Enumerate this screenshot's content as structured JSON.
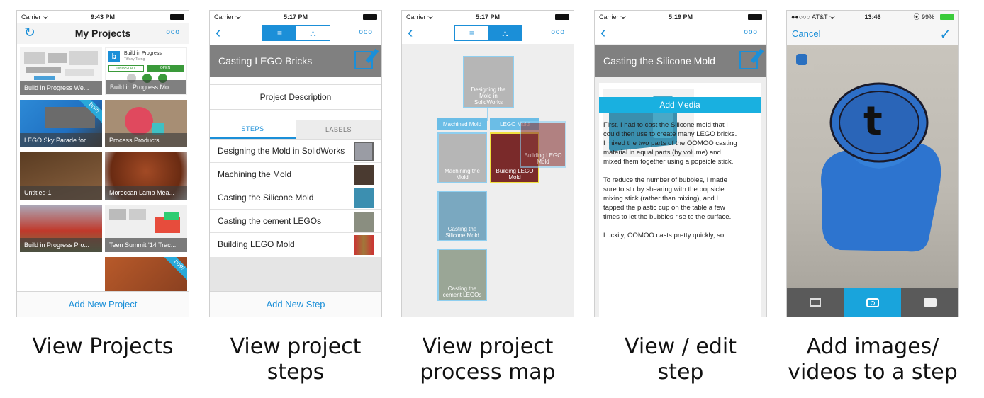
{
  "screens": [
    {
      "status": {
        "carrier": "Carrier ᯤ",
        "time": "9:43 PM"
      },
      "title": "My Projects",
      "more": "ooo",
      "projects": [
        {
          "label": "Build in Progress We..."
        },
        {
          "label": "Build in Progress Mo..."
        },
        {
          "label": "LEGO Sky Parade for..."
        },
        {
          "label": "Process Products"
        },
        {
          "label": "Untitled-1"
        },
        {
          "label": "Moroccan Lamb Mea..."
        },
        {
          "label": "Build in Progress Pro..."
        },
        {
          "label": "Teen Summit '14 Trac..."
        }
      ],
      "promo": {
        "title": "Build in Progress",
        "author": "Tiffany Tseng",
        "btn1": "UNINSTALL",
        "btn2": "OPEN"
      },
      "ribbon": "built!",
      "bottom": "Add New Project",
      "caption": "View Projects"
    },
    {
      "status": {
        "carrier": "Carrier ᯤ",
        "time": "5:17 PM"
      },
      "more": "ooo",
      "header": "Casting LEGO Bricks",
      "description": "Project Description",
      "tabs": [
        "STEPS",
        "LABELS"
      ],
      "steps": [
        "Designing the Mold in SolidWorks",
        "Machining the Mold",
        "Casting the Silicone Mold",
        "Casting the cement LEGOs",
        "Building LEGO Mold"
      ],
      "bottom": "Add New Step",
      "caption_lines": [
        "View project",
        "steps"
      ]
    },
    {
      "status": {
        "carrier": "Carrier ᯤ",
        "time": "5:17 PM"
      },
      "more": "ooo",
      "lanes": [
        "Machined Mold",
        "LEGO Mold"
      ],
      "nodes": [
        "Designing the Mold in SolidWorks",
        "Machining the Mold",
        "Building LEGO Mold",
        "Building LEGO Mold",
        "Casting the Silicone Mold",
        "Casting the cement LEGOs"
      ],
      "caption_lines": [
        "View project",
        "process map"
      ]
    },
    {
      "status": {
        "carrier": "Carrier ᯤ",
        "time": "5:19 PM"
      },
      "more": "ooo",
      "header": "Casting the Silicone Mold",
      "add_media": "Add Media",
      "description": "First, I had to cast the Silicone mold that I\ncould then use to create many LEGO bricks.\n I mixed the two parts of the OOMOO casting\nmaterial in equal parts (by volume) and\nmixed them together using a popsicle stick.\n\nTo reduce the number of bubbles, I made\nsure to stir by shearing with the popsicle\nmixing stick (rather than mixing), and I\ntapped the plastic cup on the table a few\ntimes to let the bubbles rise to the surface.\n\nLuckily, OOMOO casts pretty quickly, so",
      "caption_lines": [
        "View / edit",
        "step"
      ]
    },
    {
      "status": {
        "carrier": "●●○○○ AT&T ᯤ",
        "time": "13:46",
        "battery": "⦿ 99%"
      },
      "cancel": "Cancel",
      "done": "✓",
      "caption_lines": [
        "Add images/",
        "videos to a step"
      ]
    }
  ],
  "colors": {
    "accent": "#1b8fd8",
    "header_gray": "#808080",
    "media_button": "#19b0e0",
    "camera_select": "#19a4dc"
  }
}
